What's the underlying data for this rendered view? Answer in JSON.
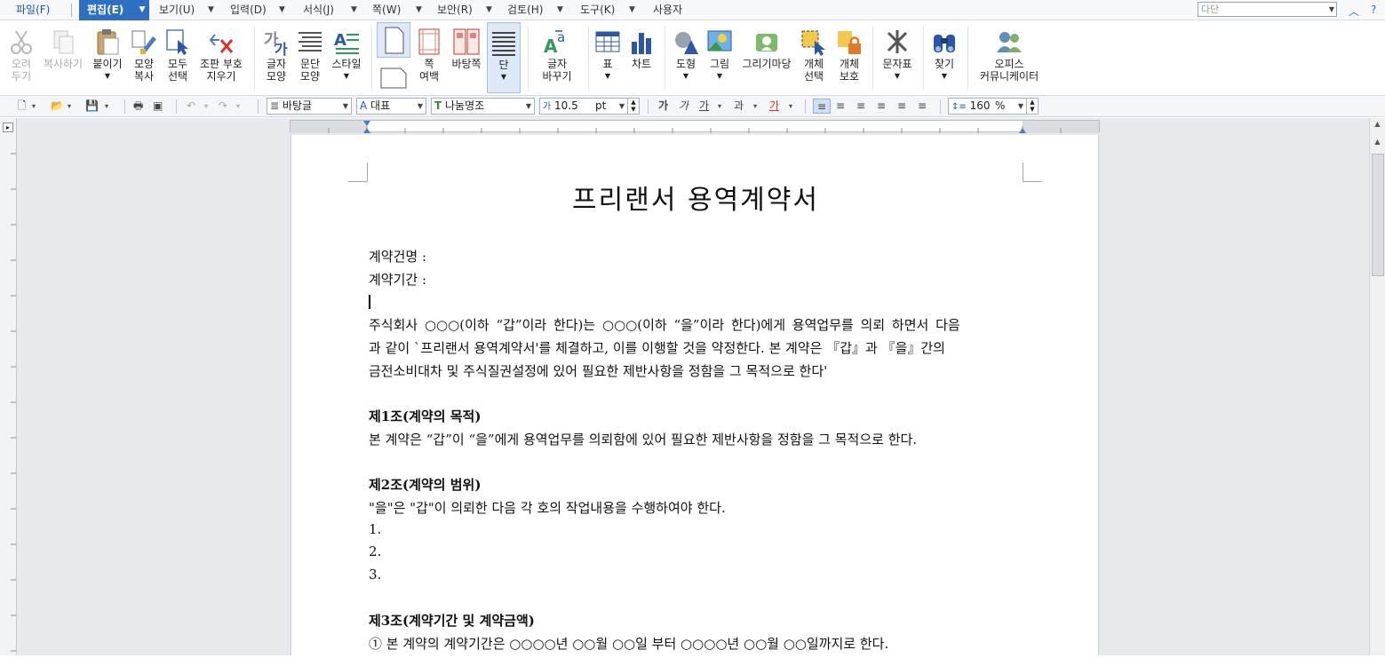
{
  "menubar": {
    "items": [
      "파일(F)",
      "편집(E)",
      "보기(U)",
      "입력(D)",
      "서식(J)",
      "쪽(W)",
      "보안(R)",
      "검토(H)",
      "도구(K)",
      "사용자"
    ],
    "style_box_placeholder": "다단"
  },
  "ribbon": {
    "cut": "오려\n두기",
    "copy": "복사하기",
    "paste": "붙이기",
    "format_copy": "모양\n복사",
    "select_all": "모두\n선택",
    "erase_marks": "조판 부호\n지우기",
    "char_shape": "글자\n모양",
    "para_shape": "문단\n모양",
    "style": "스타일",
    "page_margin": "쪽\n여백",
    "background": "바탕쪽",
    "columns": "단",
    "replace": "글자\n바꾸기",
    "table": "표",
    "chart": "차트",
    "shape": "도형",
    "picture": "그림",
    "clipart": "그리기마당",
    "object_select": "개체\n선택",
    "object_protect": "개체\n보호",
    "symbol": "문자표",
    "find": "찾기",
    "office_community": "오피스\n커뮤니케이터"
  },
  "toolbar": {
    "style": "바탕글",
    "lang": "대표",
    "font": "나눔명조",
    "size": "10.5",
    "unit": "pt",
    "zoom": "160",
    "zoom_unit": "%"
  },
  "document": {
    "title": "프리랜서 용역계약서",
    "line_contract_name": "계약건명 :",
    "line_contract_period": "계약기간 :",
    "intro1": "주식회사 ○○○(이하 “갑”이라 한다)는 ○○○(이하 “을”이라 한다)에게 용역업무를 의뢰 하면서 다음",
    "intro2": "과 같이 `프리랜서 용역계약서'를 체결하고, 이를 이행할 것을 약정한다. 본 계약은 『갑』과 『을』간의",
    "intro3": "금전소비대차 및 주식질권설정에 있어 필요한 제반사항을 정함을 그 목적으로 한다'",
    "art1_title": "제1조(계약의 목적)",
    "art1_body": "본 계약은 “갑”이 “을”에게 용역업무를 의뢰함에 있어 필요한 제반사항을 정함을 그 목적으로 한다.",
    "art2_title": "제2조(계약의 범위)",
    "art2_body": "\"을\"은 \"갑\"이 의뢰한 다음 각 호의 작업내용을 수행하여야 한다.",
    "item1": "1.",
    "item2": "2.",
    "item3": "3.",
    "art3_title": "제3조(계약기간 및 계약금액)",
    "art3_body": "① 본 계약의 계약기간은 ○○○○년 ○○월 ○○일 부터 ○○○○년 ○○월 ○○일까지로 한다."
  }
}
